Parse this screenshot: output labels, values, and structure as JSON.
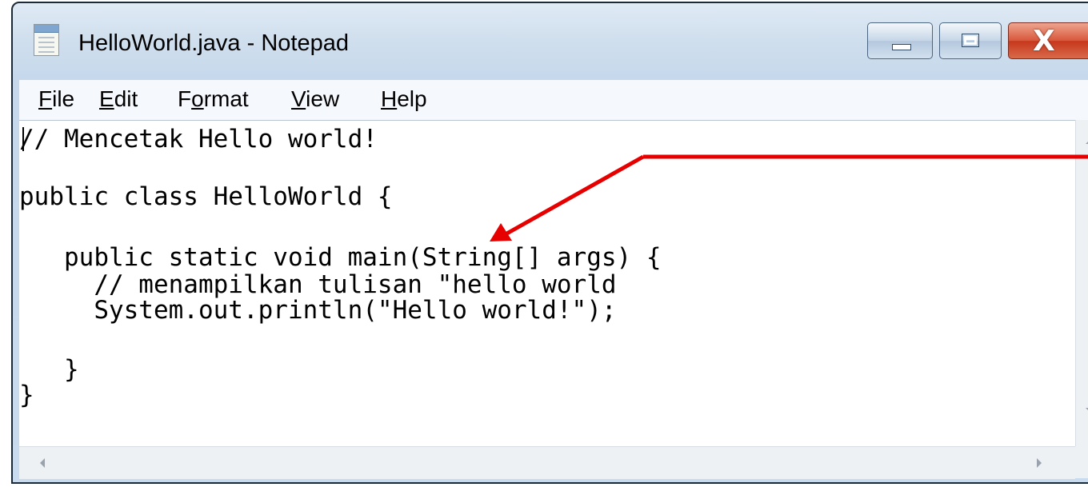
{
  "window": {
    "title": "HelloWorld.java - Notepad",
    "app_icon": "notepad-icon"
  },
  "caption_buttons": {
    "minimize_icon": "minimize-icon",
    "maximize_icon": "maximize-icon",
    "close_icon": "close-icon",
    "close_glyph": "X"
  },
  "menu": {
    "items": [
      {
        "accel": "F",
        "rest": "ile"
      },
      {
        "accel": "E",
        "rest": "dit"
      },
      {
        "pre": "F",
        "accel": "o",
        "rest": "rmat"
      },
      {
        "accel": "V",
        "rest": "iew"
      },
      {
        "accel": "H",
        "rest": "elp"
      }
    ]
  },
  "editor": {
    "lines": [
      "// Mencetak Hello world!",
      "",
      "public class HelloWorld {",
      "",
      "   public static void main(String[] args) {",
      "     // menampilkan tulisan \"hello world",
      "     System.out.println(\"Hello world!\");",
      "",
      "   }",
      "}"
    ]
  },
  "annotation": {
    "color": "#e60000",
    "icon": "red-arrow-pointer"
  }
}
